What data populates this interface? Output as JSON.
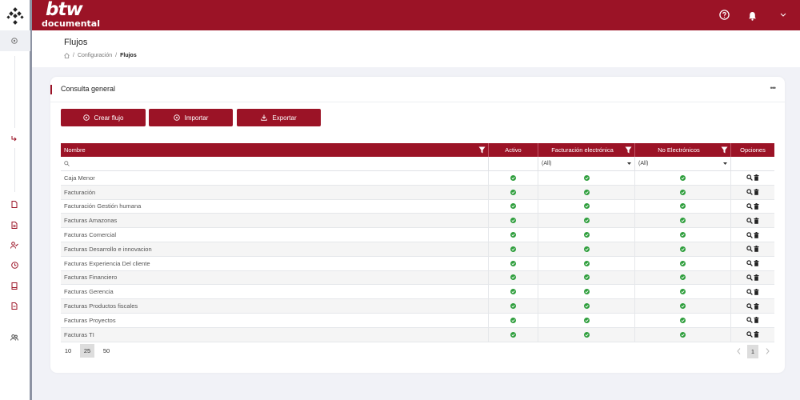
{
  "brand": {
    "top": "btw",
    "bottom": "documental"
  },
  "header": {
    "help_icon": "help-circle-icon",
    "bell_icon": "bell-icon",
    "chevron_icon": "chevron-down-icon"
  },
  "page": {
    "title": "Flujos",
    "breadcrumb": [
      "Configuración",
      "Flujos"
    ]
  },
  "card": {
    "title": "Consulta general",
    "menu": "•••",
    "buttons": {
      "crear": "Crear flujo",
      "importar": "Importar",
      "exportar": "Exportar"
    }
  },
  "grid": {
    "columns": [
      "Nombre",
      "Activo",
      "Facturación electrónica",
      "No Electrónicos",
      "Opciones"
    ],
    "filters": {
      "facturacion": "(All)",
      "no_electronicos": "(All)"
    },
    "rows": [
      "Caja Menor",
      "Facturación",
      "Facturación Gestión humana",
      "Facturas Amazonas",
      "Facturas Comercial",
      "Facturas Desarrollo e innovacion",
      "Facturas Experiencia Del cliente",
      "Facturas Financiero",
      "Facturas Gerencia",
      "Facturas Productos fiscales",
      "Facturas Proyectos",
      "Facturas TI"
    ]
  },
  "pager": {
    "sizes": [
      "10",
      "25",
      "50"
    ],
    "selected_size": "25",
    "current_page": "1"
  },
  "colors": {
    "brand": "#9b1326",
    "check": "#2e9e3c"
  }
}
